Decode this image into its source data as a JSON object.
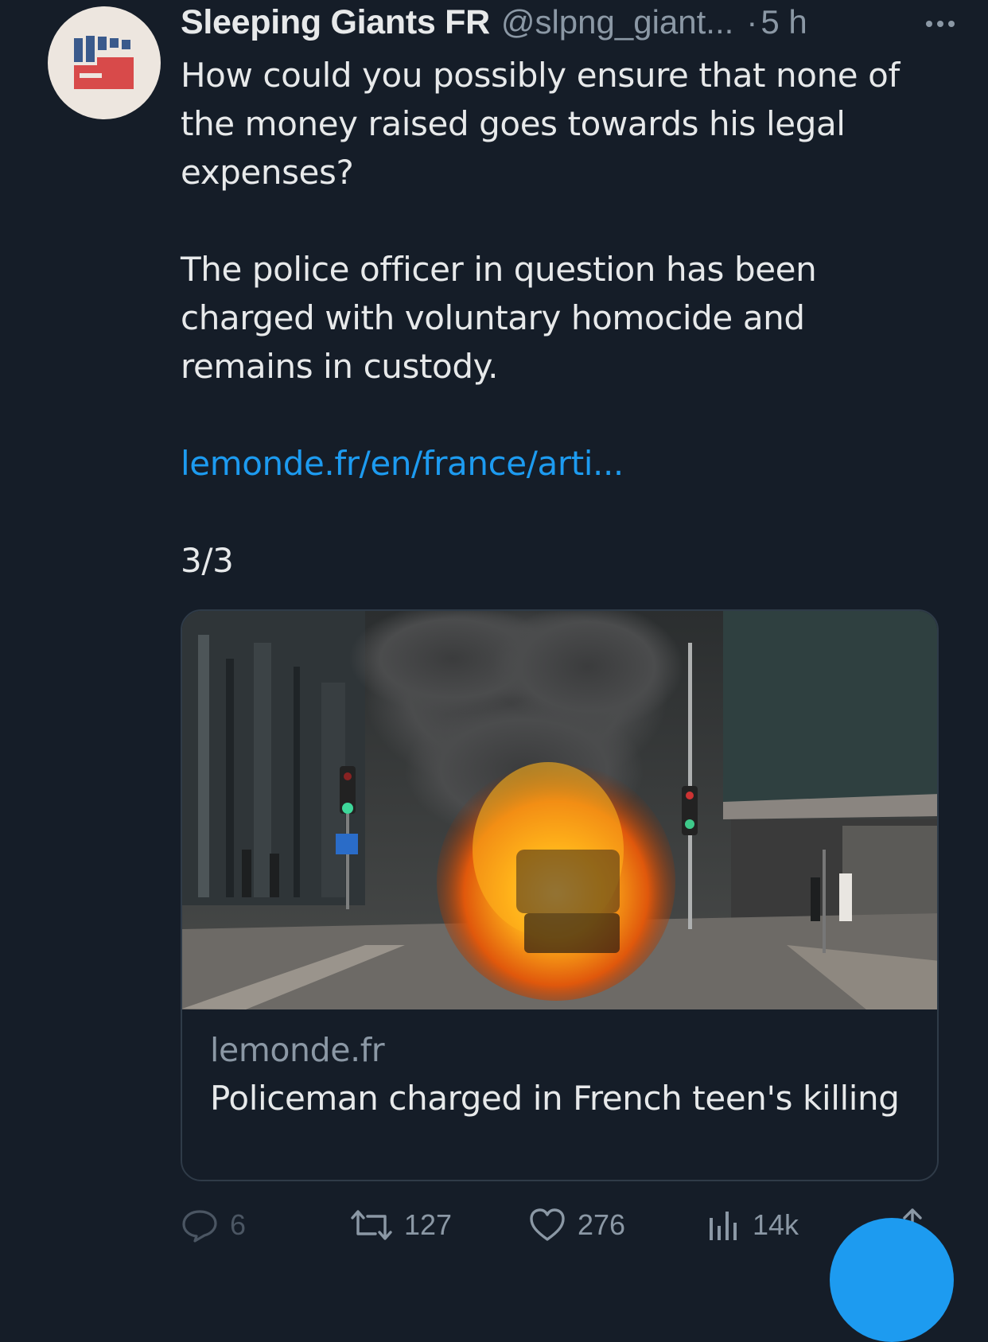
{
  "tweet": {
    "author_name": "Sleeping Giants FR",
    "handle": "@slpng_giant...",
    "separator": "·",
    "time": "5 h",
    "text": {
      "paragraph1": "How could you possibly ensure that none of the money raised goes towards his legal expenses?",
      "paragraph2": "The police officer in question has been charged with voluntary homocide and remains in custody.",
      "link": "lemonde.fr/en/france/arti...",
      "thread_position": "3/3"
    },
    "card": {
      "domain": "lemonde.fr",
      "title": "Policeman charged in French teen's killing"
    },
    "actions": {
      "replies": "6",
      "retweets": "127",
      "likes": "276",
      "views": "14k"
    }
  },
  "icons": {
    "avatar": "fist-logo",
    "more": "more-horizontal-icon",
    "reply": "reply-icon",
    "retweet": "retweet-icon",
    "like": "heart-icon",
    "views": "views-chart-icon",
    "share": "share-icon"
  },
  "colors": {
    "background": "#151d28",
    "text_primary": "#e7e9ea",
    "text_secondary": "#8b98a5",
    "link": "#1d9bf0",
    "card_border": "#2f3b48",
    "avatar_blue": "#3a5a8c",
    "avatar_red": "#d84a4a"
  }
}
